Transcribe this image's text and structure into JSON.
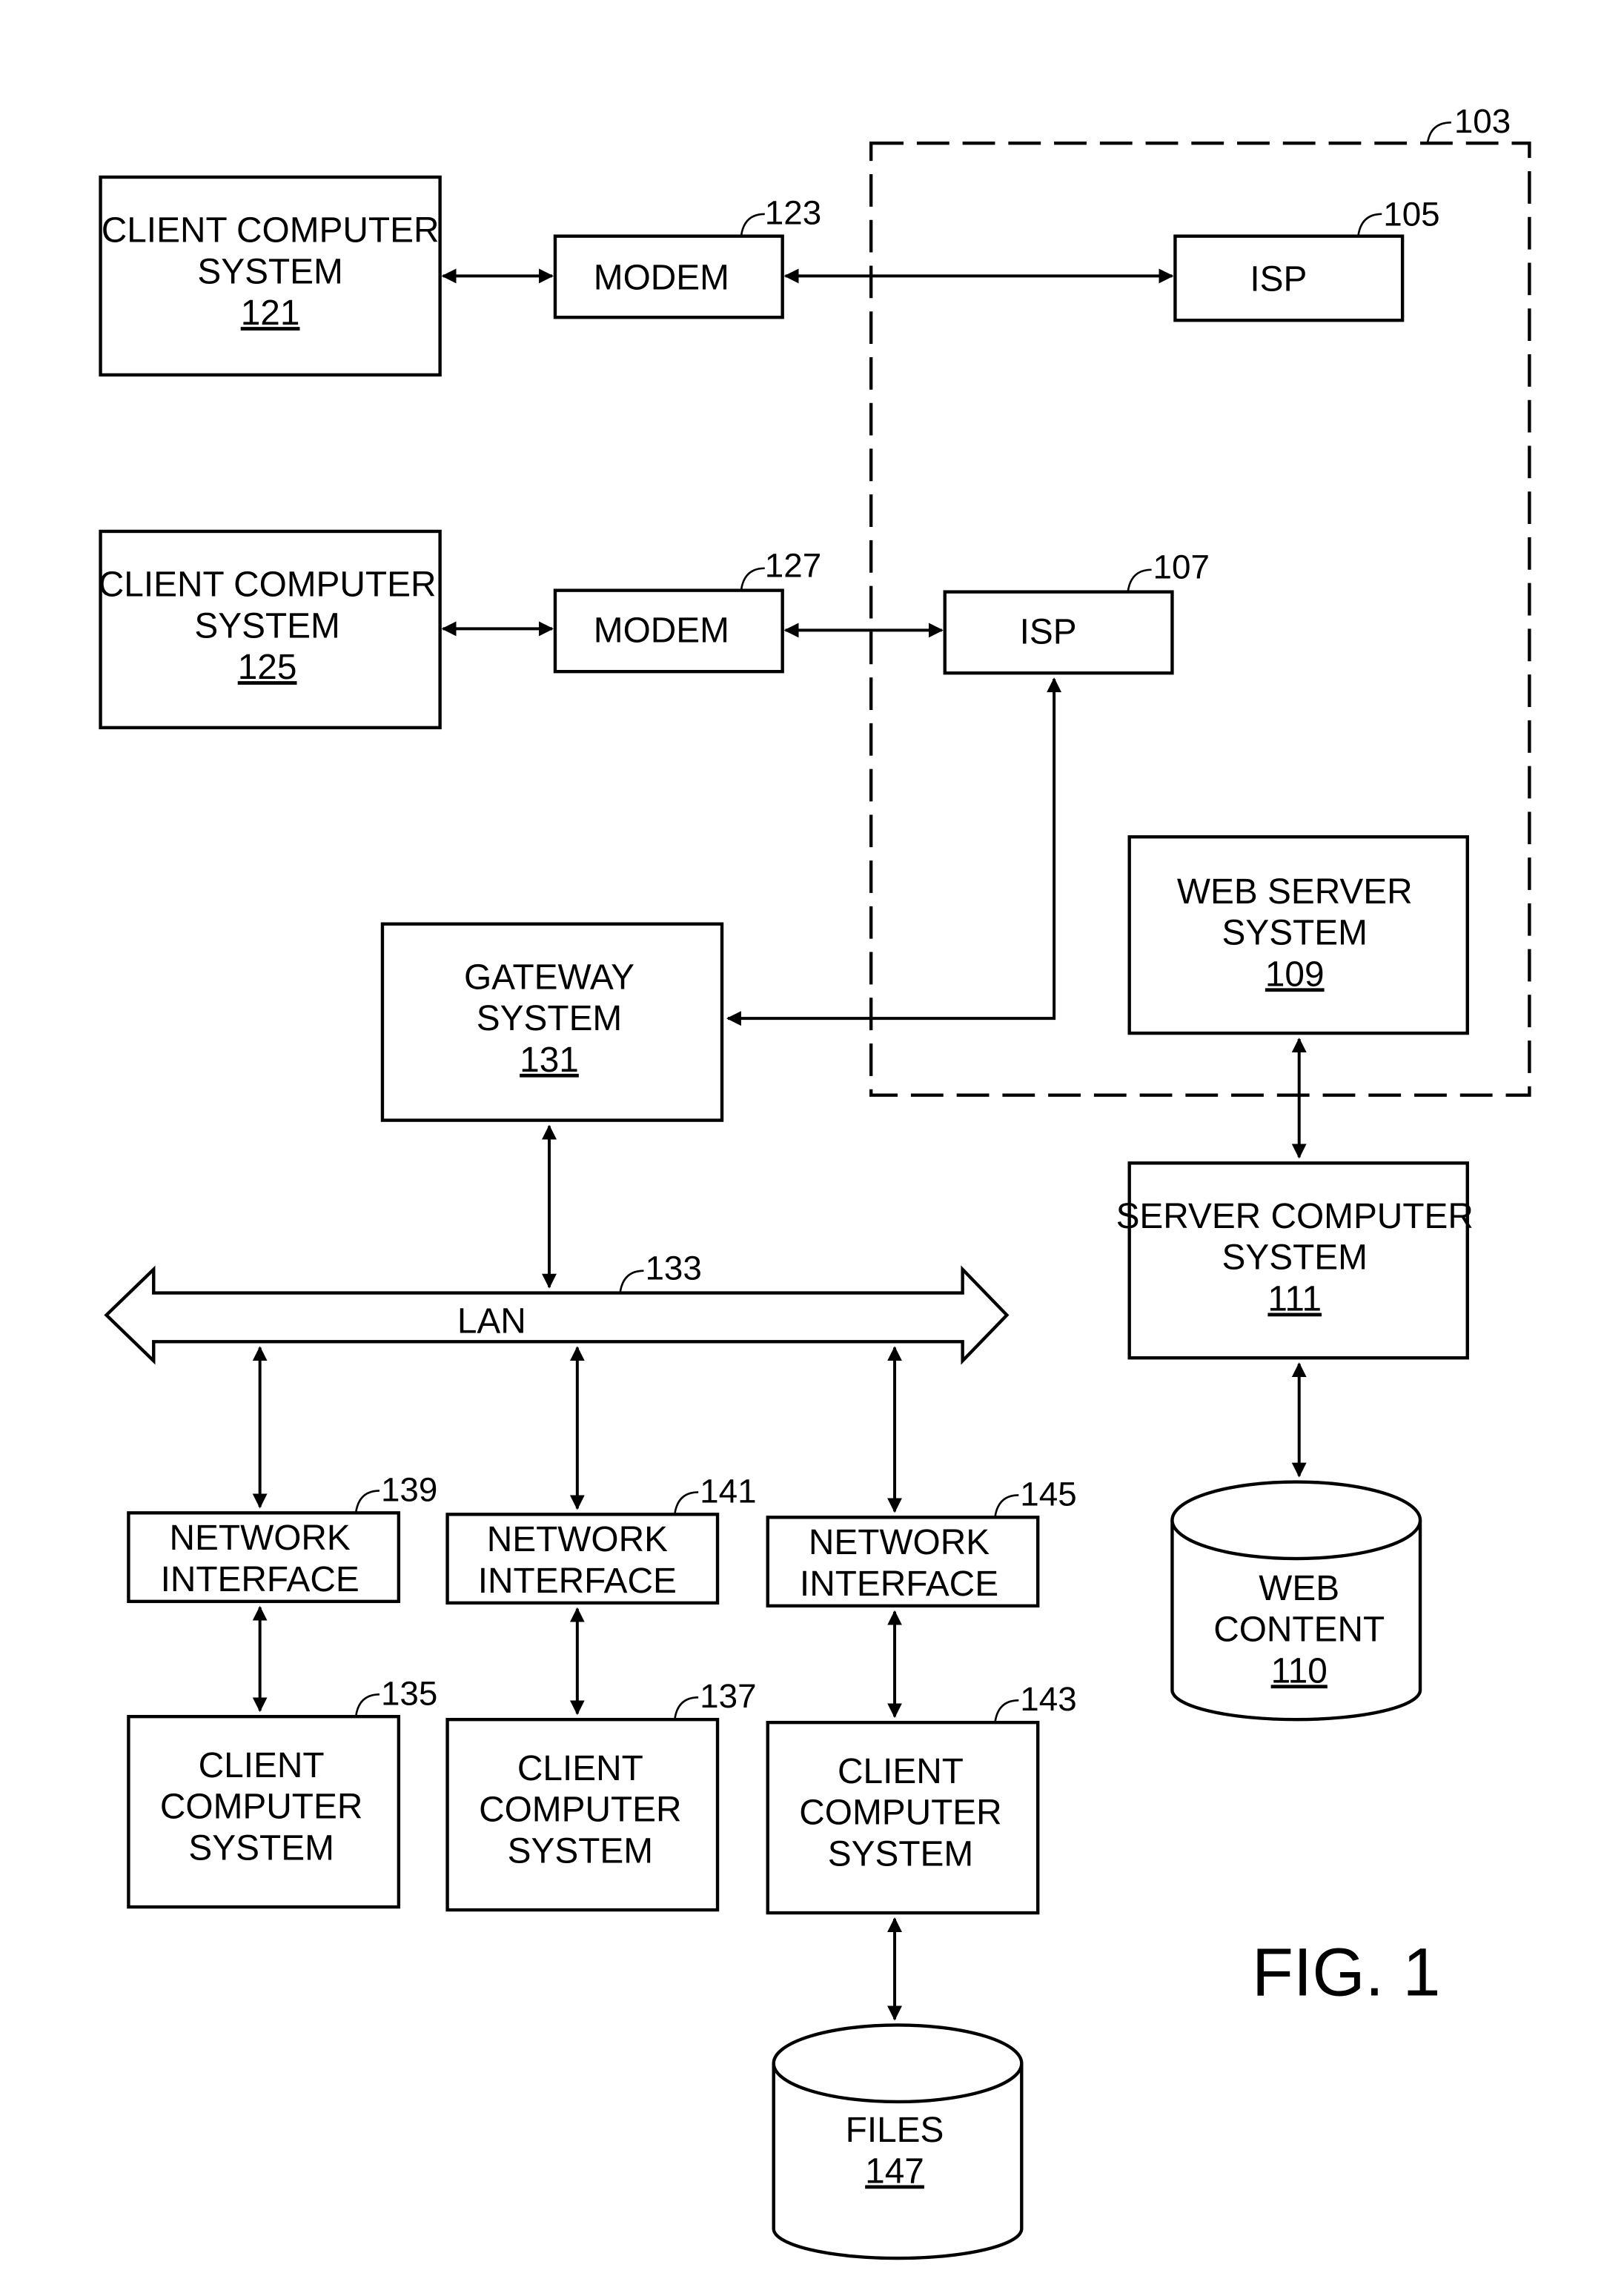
{
  "figure_label": "FIG. 1",
  "internet_boundary": {
    "ref": "103"
  },
  "nodes": {
    "client121": {
      "lines": [
        "CLIENT COMPUTER",
        "SYSTEM"
      ],
      "num": "121"
    },
    "modem123": {
      "lines": [
        "MODEM"
      ],
      "ref": "123"
    },
    "isp105": {
      "lines": [
        "ISP"
      ],
      "ref": "105"
    },
    "client125": {
      "lines": [
        "CLIENT COMPUTER",
        "SYSTEM"
      ],
      "num": "125"
    },
    "modem127": {
      "lines": [
        "MODEM"
      ],
      "ref": "127"
    },
    "isp107": {
      "lines": [
        "ISP"
      ],
      "ref": "107"
    },
    "web109": {
      "lines": [
        "WEB SERVER",
        "SYSTEM"
      ],
      "num": "109"
    },
    "gateway131": {
      "lines": [
        "GATEWAY",
        "SYSTEM"
      ],
      "num": "131"
    },
    "server111": {
      "lines": [
        "SERVER COMPUTER",
        "SYSTEM"
      ],
      "num": "111"
    },
    "lan133": {
      "lines": [
        "LAN"
      ],
      "ref": "133"
    },
    "webcontent110": {
      "lines": [
        "WEB",
        "CONTENT"
      ],
      "num": "110"
    },
    "ni139": {
      "lines": [
        "NETWORK",
        "INTERFACE"
      ],
      "ref": "139"
    },
    "ni141": {
      "lines": [
        "NETWORK",
        "INTERFACE"
      ],
      "ref": "141"
    },
    "ni145": {
      "lines": [
        "NETWORK",
        "INTERFACE"
      ],
      "ref": "145"
    },
    "client135": {
      "lines": [
        "CLIENT",
        "COMPUTER",
        "SYSTEM"
      ],
      "ref": "135"
    },
    "client137": {
      "lines": [
        "CLIENT",
        "COMPUTER",
        "SYSTEM"
      ],
      "ref": "137"
    },
    "client143": {
      "lines": [
        "CLIENT",
        "COMPUTER",
        "SYSTEM"
      ],
      "ref": "143"
    },
    "files147": {
      "lines": [
        "FILES"
      ],
      "num": "147"
    }
  }
}
